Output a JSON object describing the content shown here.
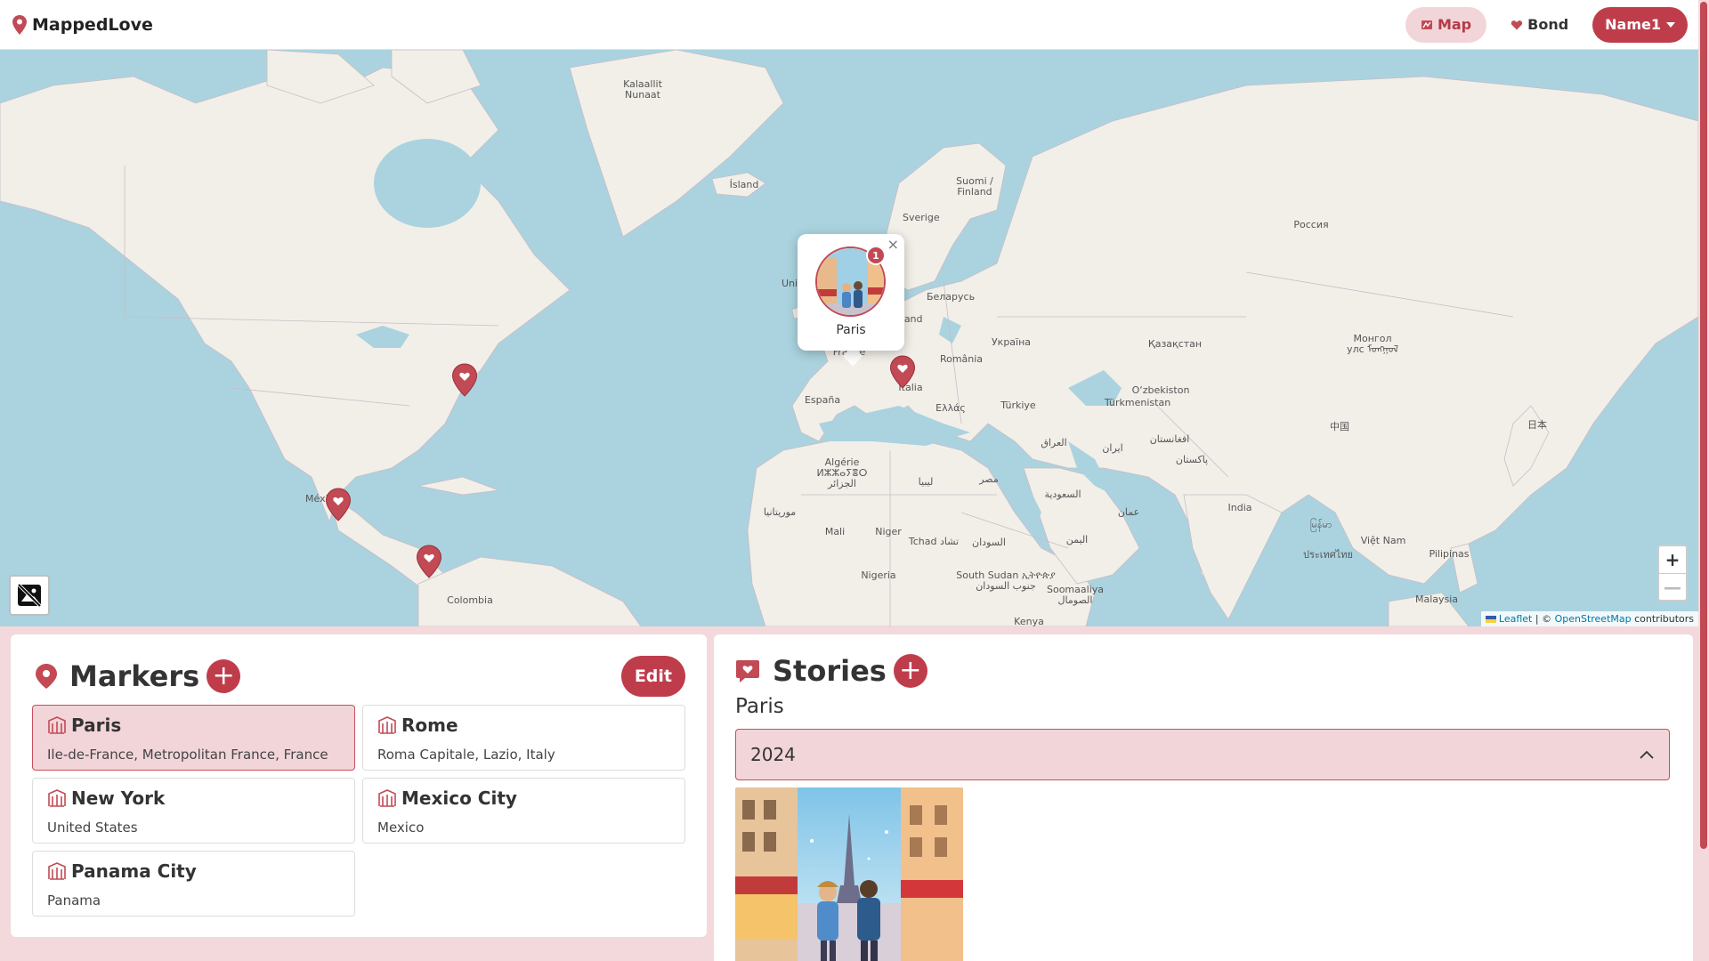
{
  "app": {
    "brand": "MappedLove"
  },
  "nav": {
    "map_label": "Map",
    "bond_label": "Bond",
    "user_label": "Name1"
  },
  "map": {
    "labels": {
      "kalaallit": "Kalaallit\nNunaat",
      "island": "Ísland",
      "suomi": "Suomi /\nFinland",
      "sverige": "Sverige",
      "rossiya": "Россия",
      "belarus": "Беларусь",
      "deutschland": "Deutschland",
      "ukraina": "Україна",
      "france": "France",
      "romania": "România",
      "kazakhstan": "Қазақстан",
      "mongol": "Монгол\nулс ᠮᠤᠩᠭᠤᠯ",
      "uzbekistan": "O‘zbekiston",
      "turkmenistan": "Türkmenistan",
      "espana": "España",
      "italia": "Italia",
      "ellas": "Ελλάς",
      "turkiye": "Türkiye",
      "zhongguo": "中国",
      "nihon": "日本",
      "algerie": "Algérie\nⵍⵣⵣⴰⵢⴻⵔ\nالجزائر",
      "libya": "ليبيا",
      "misr": "مصر",
      "iraq": "العراق",
      "iran": "ایران",
      "afghanistan": "افغانستان",
      "pakistan": "پاکستان",
      "india": "India",
      "saudi": "السعودية",
      "oman": "عمان",
      "yemen": "اليمن",
      "mauritania": "موريتانيا",
      "mali": "Mali",
      "niger": "Niger",
      "tchad": "Tchad تشاد",
      "sudan": "السودان",
      "nigeria": "Nigeria",
      "southsudan": "South Sudan ኢትዮጵያ\nجنوب السودان",
      "somalia": "Soomaaliya\nالصومال",
      "kenya": "Kenya",
      "myanmar": "မြန်မာ",
      "thailand": "ประเทศไทย",
      "vietnam": "Việt Nam",
      "pilipinas": "Pilipinas",
      "malaysia": "Malaysia",
      "mexico": "México",
      "colombia": "Colombia",
      "uk": "Uni"
    },
    "popup": {
      "title": "Paris",
      "count": "1"
    },
    "zoom_in": "+",
    "zoom_out": "—",
    "attribution": {
      "leaflet": "Leaflet",
      "sep": " | © ",
      "osm": "OpenStreetMap",
      "rest": " contributors"
    }
  },
  "markers_panel": {
    "title": "Markers",
    "add": "+",
    "edit": "Edit",
    "items": [
      {
        "name": "Paris",
        "location": "Ile-de-France, Metropolitan France, France"
      },
      {
        "name": "Rome",
        "location": "Roma Capitale, Lazio, Italy"
      },
      {
        "name": "New York",
        "location": "United States"
      },
      {
        "name": "Mexico City",
        "location": "Mexico"
      },
      {
        "name": "Panama City",
        "location": "Panama"
      }
    ]
  },
  "stories_panel": {
    "title": "Stories",
    "add": "+",
    "place": "Paris",
    "year": "2024"
  },
  "colors": {
    "accent": "#bf3d4b",
    "accent_light": "#f2d5d9",
    "water": "#aad3df",
    "land": "#f2efe9"
  }
}
